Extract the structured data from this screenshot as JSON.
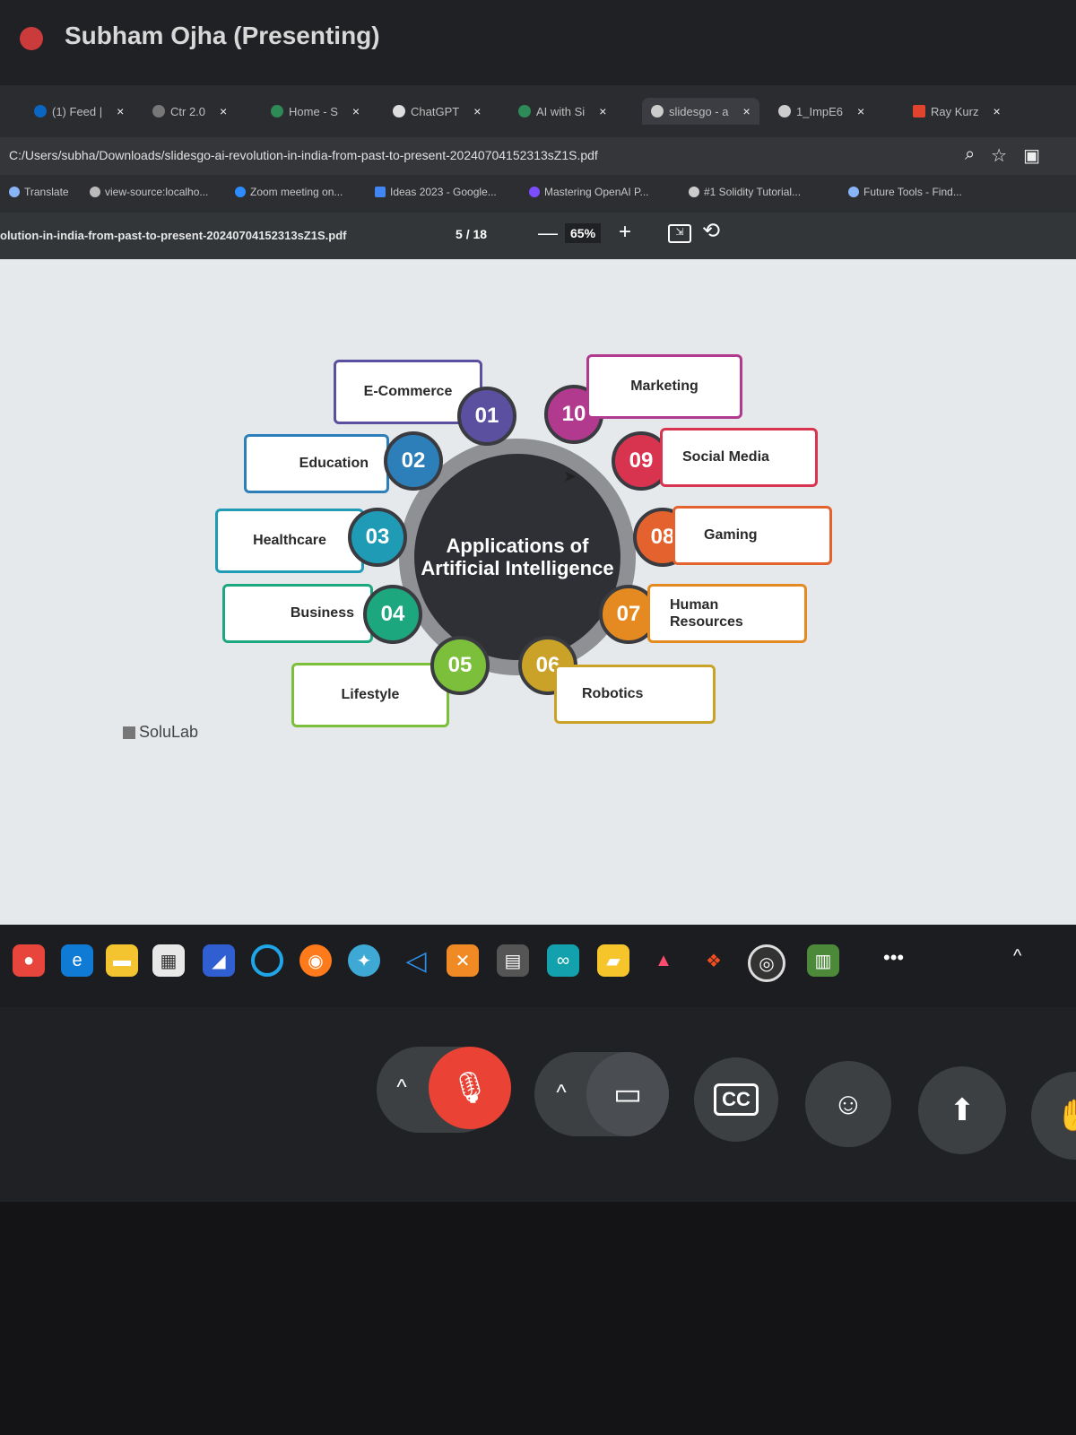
{
  "presenter": {
    "name": "Subham Ojha (Presenting)"
  },
  "tabs": [
    {
      "label": "(1) Feed |"
    },
    {
      "label": "Ctr 2.0"
    },
    {
      "label": "Home - S"
    },
    {
      "label": "ChatGPT"
    },
    {
      "label": "AI with Si"
    },
    {
      "label": "slidesgo - a"
    },
    {
      "label": "1_ImpE6"
    },
    {
      "label": "Ray Kurz"
    }
  ],
  "url": "C:/Users/subha/Downloads/slidesgo-ai-revolution-in-india-from-past-to-present-20240704152313sZ1S.pdf",
  "bookmarks": [
    {
      "label": "Translate"
    },
    {
      "label": "view-source:localho..."
    },
    {
      "label": "Zoom meeting on..."
    },
    {
      "label": "Ideas 2023 - Google..."
    },
    {
      "label": "Mastering OpenAI P..."
    },
    {
      "label": "#1 Solidity Tutorial..."
    },
    {
      "label": "Future Tools - Find..."
    }
  ],
  "pdf": {
    "filename": "olution-in-india-from-past-to-present-20240704152313sZ1S.pdf",
    "page_current": "5",
    "page_total": "/ 18",
    "zoom": "65%",
    "minus": "—",
    "plus": "+"
  },
  "slide": {
    "center_title": "Applications of Artificial Intelligence",
    "brand": "SoluLab",
    "items": [
      {
        "num": "01",
        "label": "E-Commerce",
        "color": "#5b4fa0"
      },
      {
        "num": "02",
        "label": "Education",
        "color": "#2c7fb8"
      },
      {
        "num": "03",
        "label": "Healthcare",
        "color": "#1f9bb5"
      },
      {
        "num": "04",
        "label": "Business",
        "color": "#1ca77f"
      },
      {
        "num": "05",
        "label": "Lifestyle",
        "color": "#7cbf3b"
      },
      {
        "num": "06",
        "label": "Robotics",
        "color": "#c9a227"
      },
      {
        "num": "07",
        "label": "Human Resources",
        "color": "#e58a21"
      },
      {
        "num": "08",
        "label": "Gaming",
        "color": "#e4622d"
      },
      {
        "num": "09",
        "label": "Social Media",
        "color": "#d9344f"
      },
      {
        "num": "10",
        "label": "Marketing",
        "color": "#b23a8e"
      }
    ]
  },
  "taskbar": {
    "more": "•••",
    "caret": "^"
  },
  "controls": {
    "cc": "CC"
  }
}
